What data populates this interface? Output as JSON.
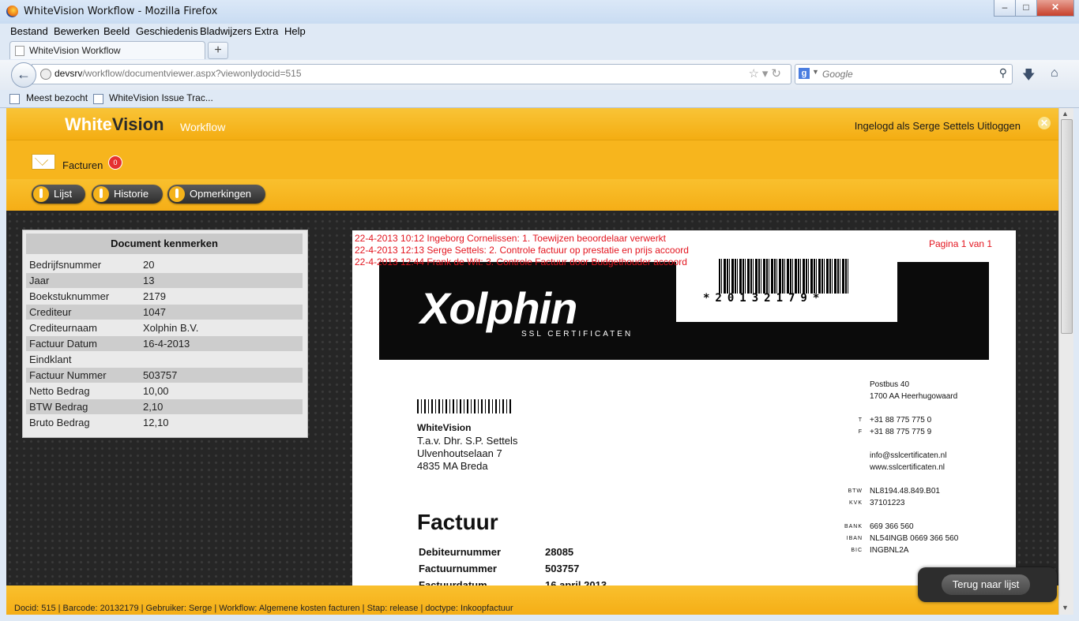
{
  "window": {
    "title": "WhiteVision Workflow - Mozilla Firefox"
  },
  "menu": [
    "Bestand",
    "Bewerken",
    "Beeld",
    "Geschiedenis",
    "Bladwijzers",
    "Extra",
    "Help"
  ],
  "tab": {
    "label": "WhiteVision Workflow"
  },
  "navbar": {
    "url_host": "devsrv",
    "url_path": "/workflow/documentviewer.aspx?viewonlydocid=515",
    "search_placeholder": "Google",
    "search_engine": "g"
  },
  "bookmarks": [
    "Meest bezocht",
    "WhiteVision Issue Trac..."
  ],
  "app": {
    "logo_white": "White",
    "logo_dark": "Vision",
    "logo_sub": "Workflow",
    "login_text": "Ingelogd als Serge Settels Uitloggen",
    "section": "Facturen",
    "badge": "0",
    "buttons": [
      "Lijst",
      "Historie",
      "Opmerkingen"
    ]
  },
  "panel": {
    "title": "Document kenmerken",
    "rows": [
      {
        "k": "Bedrijfsnummer",
        "v": "20"
      },
      {
        "k": "Jaar",
        "v": "13"
      },
      {
        "k": "Boekstuknummer",
        "v": "2179"
      },
      {
        "k": "Crediteur",
        "v": "1047"
      },
      {
        "k": "Crediteurnaam",
        "v": "Xolphin B.V."
      },
      {
        "k": "Factuur Datum",
        "v": "16-4-2013"
      },
      {
        "k": "Eindklant",
        "v": ""
      },
      {
        "k": "Factuur Nummer",
        "v": "503757"
      },
      {
        "k": "Netto Bedrag",
        "v": "10,00"
      },
      {
        "k": "BTW Bedrag",
        "v": "2,10"
      },
      {
        "k": "Bruto Bedrag",
        "v": "12,10"
      }
    ]
  },
  "document": {
    "log": [
      "22-4-2013 10:12 Ingeborg Cornelissen: 1. Toewijzen beoordelaar verwerkt",
      "22-4-2013 12:13 Serge Settels: 2. Controle factuur op prestatie en prijs accoord",
      "22-4-2013 12:44 Frank de Wit: 3. Controle Factuur door Budgethouder accoord"
    ],
    "pagina": "Pagina 1 van 1",
    "brand": "Xolphin",
    "brand_sub": "SSL CERTIFICATEN",
    "barcode": "*20132179*",
    "address": [
      "WhiteVision",
      "T.a.v. Dhr. S.P. Settels",
      "Ulvenhoutselaan 7",
      "4835 MA Breda"
    ],
    "sender": {
      "postbus": "Postbus 40",
      "city": "1700 AA Heerhugowaard",
      "tel_label": "T",
      "tel": "+31 88 775 775 0",
      "fax_label": "F",
      "fax": "+31 88 775 775 9",
      "email": "info@sslcertificaten.nl",
      "web": "www.sslcertificaten.nl",
      "btw_label": "BTW",
      "btw": "NL8194.48.849.B01",
      "kvk_label": "KVK",
      "kvk": "37101223",
      "bank_label": "BANK",
      "bank": "669 366 560",
      "iban_label": "IBAN",
      "iban": "NL54INGB 0669 366 560",
      "bic_label": "BIC",
      "bic": "INGBNL2A"
    },
    "heading": "Factuur",
    "fields": [
      {
        "k": "Debiteurnummer",
        "v": "28085"
      },
      {
        "k": "Factuurnummer",
        "v": "503757"
      },
      {
        "k": "Factuurdatum",
        "v": "16 april 2013"
      }
    ]
  },
  "footer": {
    "text": "Docid: 515 | Barcode: 20132179 | Gebruiker: Serge | Workflow: Algemene kosten facturen | Stap: release | doctype: Inkoopfactuur"
  },
  "back_button": "Terug naar lijst"
}
